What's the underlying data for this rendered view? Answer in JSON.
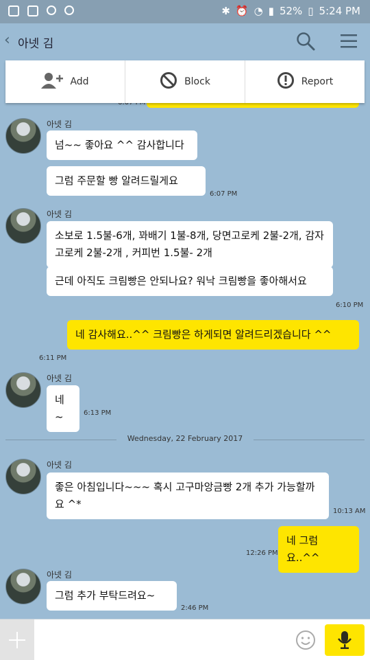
{
  "status_bar": {
    "battery": "52%",
    "time": "5:24 PM"
  },
  "header": {
    "back_icon": "chevron-left-icon",
    "title": "아넷 김"
  },
  "actions": [
    {
      "label": "Add",
      "icon": "add-person-icon"
    },
    {
      "label": "Block",
      "icon": "block-icon"
    },
    {
      "label": "Report",
      "icon": "alert-circle-icon"
    }
  ],
  "chat": {
    "peek_time": "6:07 PM",
    "groups": [
      {
        "sender": "아넷 김",
        "messages": [
          "넘~~ 좋아요 ^^ 감사합니다",
          "그럼 주문할 빵 알려드릴게요"
        ],
        "time": "6:07 PM"
      },
      {
        "sender": "아넷 김",
        "messages": [
          "소보로 1.5불-6개, 꽈배기 1불-8개, 당면고로케 2불-2개, 감자고로케 2불-2개 , 커피번 1.5불- 2개",
          "근데 아직도 크림빵은 안되나요? 워낙 크림빵을 좋아해서요"
        ],
        "time": "6:10 PM"
      },
      {
        "sender": "me",
        "messages": [
          "네 감사해요..^^ 크림빵은 하게되면 알려드리겠습니다 ^^"
        ],
        "time": "6:11 PM"
      },
      {
        "sender": "아넷 김",
        "messages": [
          "네~"
        ],
        "time": "6:13 PM"
      },
      {
        "sender": "아넷 김",
        "messages": [
          "좋은 아침입니다~~~ 혹시 고구마앙금빵 2개 추가 가능할까요 ^*"
        ],
        "time": "10:13 AM"
      },
      {
        "sender": "me",
        "messages": [
          "네 그럼요..^^"
        ],
        "time": "12:26 PM"
      },
      {
        "sender": "아넷 김",
        "messages": [
          "그럼 추가 부탁드려요~"
        ],
        "time": "2:46 PM"
      }
    ],
    "date_divider": "Wednesday, 22 February 2017"
  },
  "input_bar": {
    "placeholder": "",
    "colors": {
      "accent": "#fee500",
      "background": "#9bbbd4"
    }
  }
}
